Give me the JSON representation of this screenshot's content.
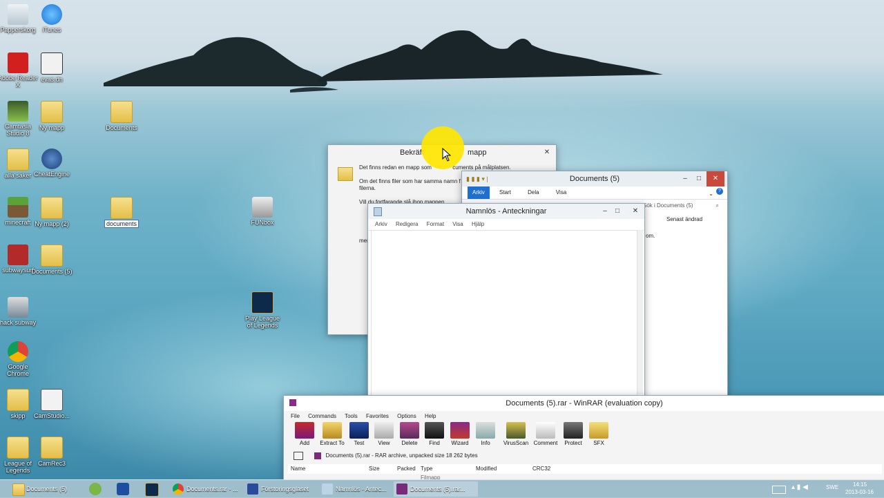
{
  "desktop": {
    "icons": [
      {
        "label": "Papperskorg"
      },
      {
        "label": "iTunes"
      },
      {
        "label": "Adobe Reader X"
      },
      {
        "label": "evas.dn"
      },
      {
        "label": "Camtasia Studio 8"
      },
      {
        "label": "Ny mapp"
      },
      {
        "label": "Documents"
      },
      {
        "label": "alla saker"
      },
      {
        "label": "CheatEngine"
      },
      {
        "label": "minecraft"
      },
      {
        "label": "Ny mapp (2)"
      },
      {
        "label": "documents"
      },
      {
        "label": "FUNbox"
      },
      {
        "label": "subwaysurf"
      },
      {
        "label": "Documents (5)"
      },
      {
        "label": "hack subway"
      },
      {
        "label": "Play League of Legends"
      },
      {
        "label": "Google Chrome"
      },
      {
        "label": "skipp"
      },
      {
        "label": "CamStudio..."
      },
      {
        "label": "League of Legends"
      },
      {
        "label": "CamRec3"
      }
    ]
  },
  "confirm_dialog": {
    "title_left": "Bekräft",
    "title_right": "mapp",
    "line1": "Det finns redan en mapp som",
    "line1b": "cuments på målplatsen.",
    "line2": "Om det finns filer som har samma namn f",
    "line2b": "filerna.",
    "line3": "Vill du fortfarande slå ihop mappen",
    "more": "mer"
  },
  "explorer": {
    "title": "Documents (5)",
    "tabs": [
      "Arkiv",
      "Start",
      "Dela",
      "Visa"
    ],
    "search_placeholder": "Sök i Documents (5)",
    "column": "Senast ändrad",
    "row_text": "om."
  },
  "notepad": {
    "title": "Namnlös - Anteckningar",
    "menu": [
      "Arkiv",
      "Redigera",
      "Format",
      "Visa",
      "Hjälp"
    ]
  },
  "winrar": {
    "title": "Documents (5).rar - WinRAR (evaluation copy)",
    "menu": [
      "File",
      "Commands",
      "Tools",
      "Favorites",
      "Options",
      "Help"
    ],
    "tools": [
      "Add",
      "Extract To",
      "Test",
      "View",
      "Delete",
      "Find",
      "Wizard",
      "Info",
      "VirusScan",
      "Comment",
      "Protect",
      "SFX"
    ],
    "path": "Documents (5).rar - RAR archive, unpacked size 18 262 bytes",
    "columns": [
      "Name",
      "Size",
      "Packed",
      "Type",
      "Modified",
      "CRC32"
    ],
    "row_type": "Filmapp"
  },
  "taskbar": {
    "tasks": [
      "Documents (5)",
      "Documents.rar - ...",
      "Förstoringsglaset",
      "Namnlös - Antec...",
      "Documents (5).rar..."
    ],
    "lang": "SWE",
    "time": "14:15",
    "date": "2013-03-16"
  },
  "colors": {
    "accent": "#1e6fd0",
    "cursor_highlight": "#ffe600"
  }
}
